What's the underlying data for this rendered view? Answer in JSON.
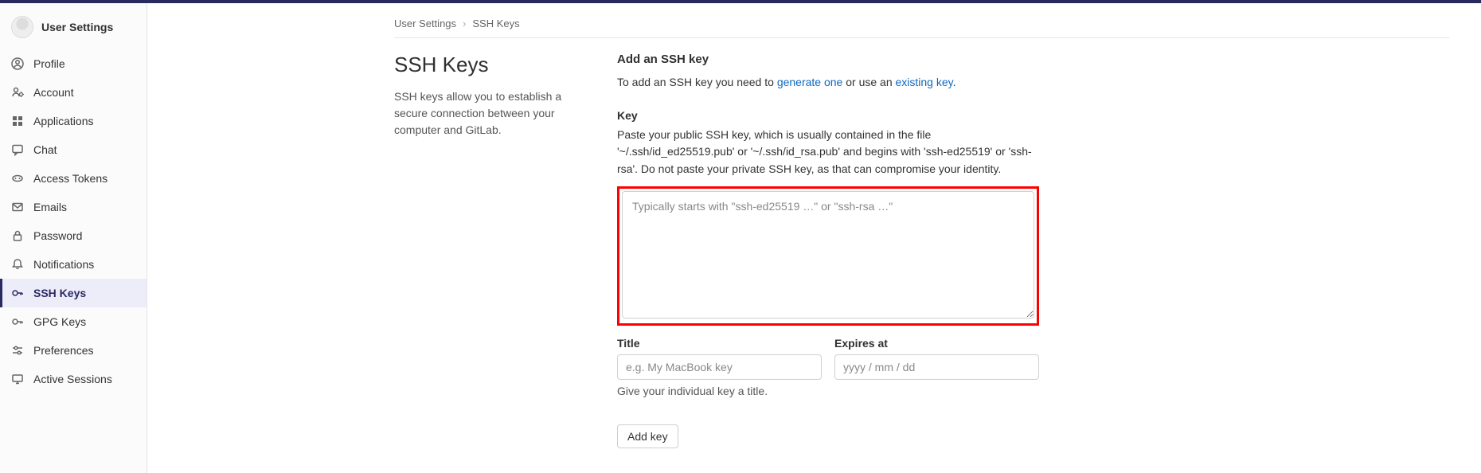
{
  "sidebar": {
    "title": "User Settings",
    "items": [
      {
        "label": "Profile",
        "icon": "profile"
      },
      {
        "label": "Account",
        "icon": "account"
      },
      {
        "label": "Applications",
        "icon": "apps"
      },
      {
        "label": "Chat",
        "icon": "chat"
      },
      {
        "label": "Access Tokens",
        "icon": "tokens"
      },
      {
        "label": "Emails",
        "icon": "emails"
      },
      {
        "label": "Password",
        "icon": "password"
      },
      {
        "label": "Notifications",
        "icon": "notifications"
      },
      {
        "label": "SSH Keys",
        "icon": "sshkeys",
        "active": true
      },
      {
        "label": "GPG Keys",
        "icon": "gpgkeys"
      },
      {
        "label": "Preferences",
        "icon": "preferences"
      },
      {
        "label": "Active Sessions",
        "icon": "sessions"
      }
    ]
  },
  "breadcrumbs": {
    "root": "User Settings",
    "leaf": "SSH Keys"
  },
  "left_col": {
    "title": "SSH Keys",
    "desc": "SSH keys allow you to establish a secure connection between your computer and GitLab."
  },
  "form": {
    "add_heading": "Add an SSH key",
    "add_intro_prefix": "To add an SSH key you need to ",
    "generate_link": "generate one",
    "add_intro_mid": " or use an ",
    "existing_link": "existing key",
    "add_intro_suffix": ".",
    "key_label": "Key",
    "key_help": "Paste your public SSH key, which is usually contained in the file '~/.ssh/id_ed25519.pub' or '~/.ssh/id_rsa.pub' and begins with 'ssh-ed25519' or 'ssh-rsa'. Do not paste your private SSH key, as that can compromise your identity.",
    "key_placeholder": "Typically starts with \"ssh-ed25519 …\" or \"ssh-rsa …\"",
    "title_label": "Title",
    "title_placeholder": "e.g. My MacBook key",
    "title_hint": "Give your individual key a title.",
    "expires_label": "Expires at",
    "expires_placeholder": "yyyy / mm / dd",
    "submit_label": "Add key"
  },
  "icons": {
    "profile": "user-circle-icon",
    "account": "user-cog-icon",
    "apps": "grid-icon",
    "chat": "speech-bubble-icon",
    "tokens": "link-chain-icon",
    "emails": "envelope-icon",
    "password": "lock-icon",
    "notifications": "bell-icon",
    "sshkeys": "key-icon",
    "gpgkeys": "key-icon",
    "preferences": "sliders-icon",
    "sessions": "monitor-icon"
  }
}
